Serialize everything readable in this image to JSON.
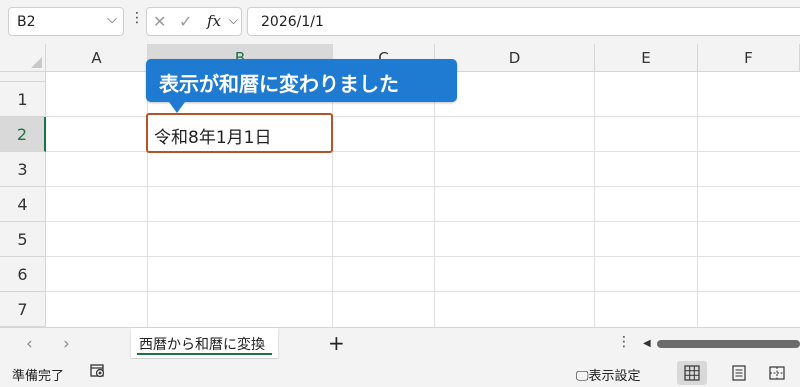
{
  "formula_bar": {
    "name_box": "B2",
    "formula": "2026/1/1"
  },
  "columns": [
    "A",
    "B",
    "C",
    "D",
    "E",
    "F"
  ],
  "rows": [
    "1",
    "2",
    "3",
    "4",
    "5",
    "6",
    "7"
  ],
  "selected_cell": "B2",
  "cell_b2_display": "令和8年1月1日",
  "callout_text": "表示が和暦に変わりました",
  "sheet_tab": "西暦から和暦に変換",
  "add_sheet": "+",
  "status": {
    "ready": "準備完了",
    "display_settings": "表示設定"
  },
  "colors": {
    "accent_green": "#1e7145",
    "callout_blue": "#1f7ad1",
    "cell_border": "#b5532a"
  }
}
